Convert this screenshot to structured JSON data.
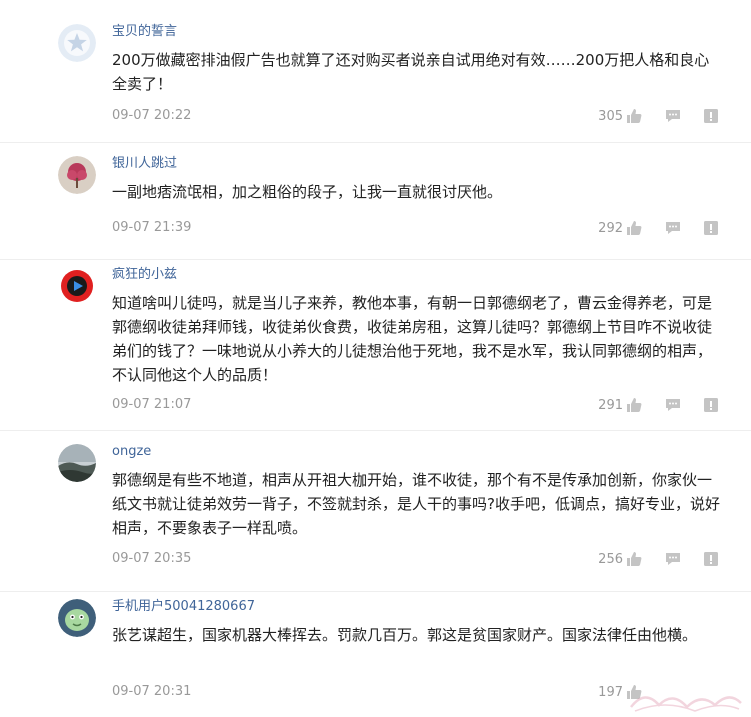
{
  "colors": {
    "username": "#406599",
    "text": "#222222",
    "meta": "#999999",
    "icon": "#c4c4c4"
  },
  "comments": [
    {
      "username": "宝贝的誓言",
      "avatar": "default-star-avatar",
      "content": "200万做藏密排油假广告也就算了还对购买者说亲自试用绝对有效……200万把人格和良心全卖了！",
      "time": "09-07 20:22",
      "likes": "305"
    },
    {
      "username": "银川人跳过",
      "avatar": "pink-tree-avatar",
      "content": "一副地痞流氓相，加之粗俗的段子，让我一直就很讨厌他。",
      "time": "09-07 21:39",
      "likes": "292"
    },
    {
      "username": "疯狂的小兹",
      "avatar": "play-logo-avatar",
      "content": "知道啥叫儿徒吗，就是当儿子来养，教他本事，有朝一日郭德纲老了，曹云金得养老，可是郭德纲收徒弟拜师钱，收徒弟伙食费，收徒弟房租，这算儿徒吗？郭德纲上节目咋不说收徒弟们的钱了？一味地说从小养大的儿徒想治他于死地，我不是水军，我认同郭德纲的相声，不认同他这个人的品质！",
      "time": "09-07 21:07",
      "likes": "291"
    },
    {
      "username": "ongze",
      "avatar": "landscape-photo-avatar",
      "content": "郭德纲是有些不地道，相声从开祖大枷开始，谁不收徒，那个有不是传承加创新，你家伙一纸文书就让徒弟效劳一背子，不签就封杀，是人干的事吗?收手吧，低调点，搞好专业，说好相声，不要象表子一样乱喷。",
      "time": "09-07 20:35",
      "likes": "256"
    },
    {
      "username": "手机用户50041280667",
      "avatar": "green-cartoon-avatar",
      "content": "张艺谋超生，国家机器大棒挥去。罚款几百万。郭这是贫国家财产。国家法律任由他横。",
      "time": "09-07 20:31",
      "likes": "197"
    }
  ]
}
